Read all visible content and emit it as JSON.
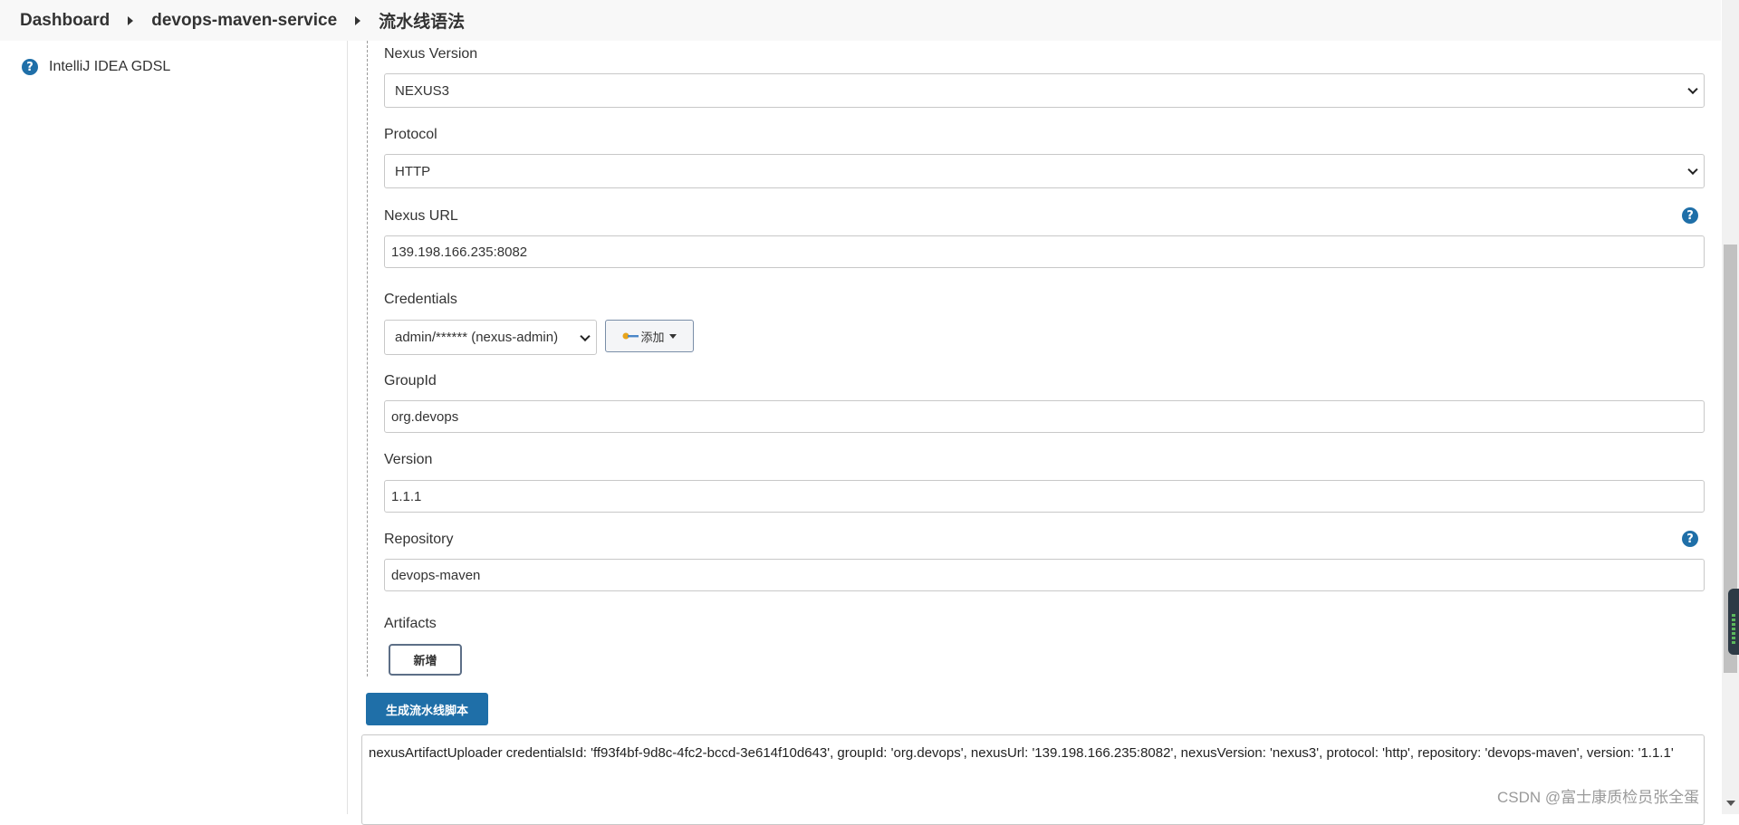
{
  "breadcrumb": {
    "items": [
      "Dashboard",
      "devops-maven-service",
      "流水线语法"
    ]
  },
  "sidebar": {
    "items": [
      {
        "label": "IntelliJ IDEA GDSL",
        "icon": "help-icon"
      }
    ]
  },
  "form": {
    "help_glyph": "?",
    "nexus_version": {
      "label": "Nexus Version",
      "value": "NEXUS3"
    },
    "protocol": {
      "label": "Protocol",
      "value": "HTTP"
    },
    "nexus_url": {
      "label": "Nexus URL",
      "value": "139.198.166.235:8082"
    },
    "credentials": {
      "label": "Credentials",
      "value": "admin/****** (nexus-admin)",
      "add_label": "添加"
    },
    "group_id": {
      "label": "GroupId",
      "value": "org.devops"
    },
    "version": {
      "label": "Version",
      "value": "1.1.1"
    },
    "repository": {
      "label": "Repository",
      "value": "devops-maven"
    },
    "artifacts": {
      "label": "Artifacts",
      "new_label": "新增"
    }
  },
  "actions": {
    "generate_label": "生成流水线脚本"
  },
  "output": {
    "script": "nexusArtifactUploader credentialsId: 'ff93f4bf-9d8c-4fc2-bccd-3e614f10d643', groupId: 'org.devops', nexusUrl: '139.198.166.235:8082', nexusVersion: 'nexus3', protocol: 'http', repository: 'devops-maven', version: '1.1.1'"
  },
  "watermark": "CSDN @富士康质检员张全蛋",
  "colors": {
    "primary": "#1f6fa8",
    "border": "#c8c8c8",
    "header_bg": "#f8f8f8"
  }
}
